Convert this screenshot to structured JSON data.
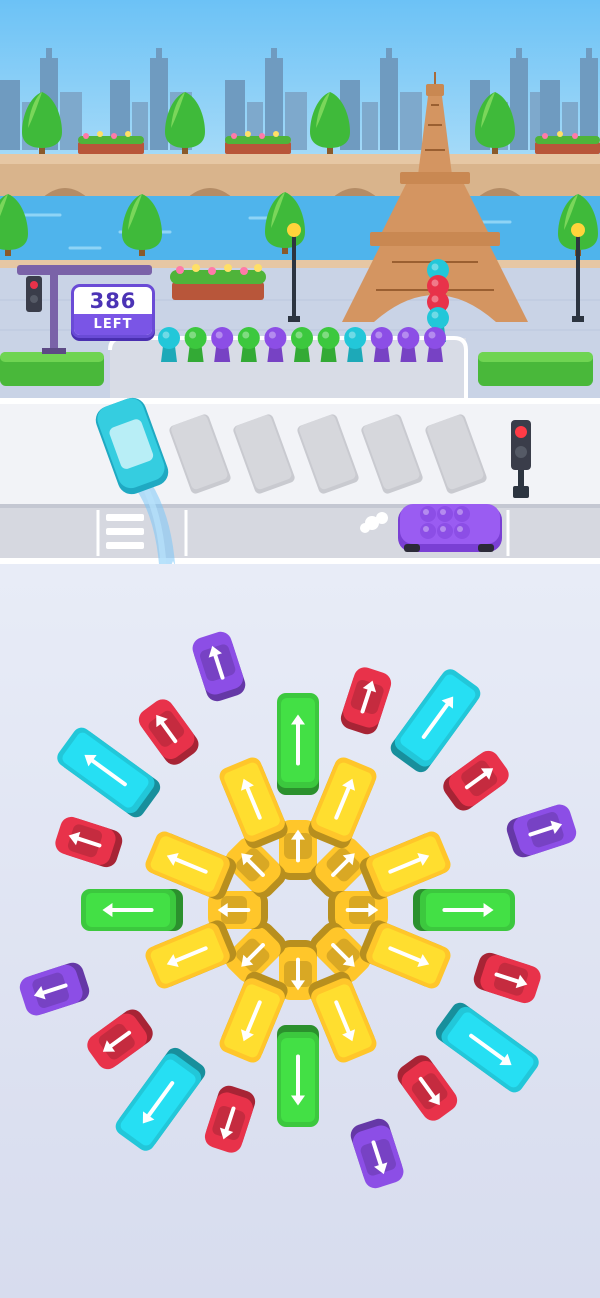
{
  "counter": {
    "value": "386",
    "label": "LEFT"
  },
  "colors": {
    "sky": "#7fc8f5",
    "river": "#4fb4ec",
    "grass": "#4fc43a",
    "road": "#d6d8e0",
    "red": "#e8324a",
    "purple": "#8c4ee6",
    "cyan": "#22c7d9",
    "green": "#3cc83e",
    "yellow": "#ffc62a"
  },
  "passenger_queue": [
    "cyan",
    "green",
    "purple",
    "green",
    "purple",
    "green",
    "green",
    "cyan",
    "purple",
    "purple",
    "purple"
  ],
  "passengers_at_tower": [
    "cyan",
    "red",
    "red",
    "cyan"
  ],
  "parked_car_passengers": [
    "purple",
    "purple",
    "purple",
    "purple",
    "purple",
    "purple"
  ],
  "parking_slots": {
    "total": 5,
    "occupied": 1
  },
  "vehicle_ring": [
    {
      "color": "green",
      "type": "bus"
    },
    {
      "color": "red",
      "type": "car"
    },
    {
      "color": "cyan",
      "type": "bus"
    },
    {
      "color": "red",
      "type": "car"
    },
    {
      "color": "purple",
      "type": "car"
    },
    {
      "color": "green",
      "type": "bus"
    },
    {
      "color": "red",
      "type": "car"
    },
    {
      "color": "cyan",
      "type": "bus"
    },
    {
      "color": "red",
      "type": "car"
    },
    {
      "color": "purple",
      "type": "car"
    },
    {
      "color": "green",
      "type": "bus"
    },
    {
      "color": "red",
      "type": "car"
    },
    {
      "color": "cyan",
      "type": "bus"
    },
    {
      "color": "red",
      "type": "car"
    },
    {
      "color": "purple",
      "type": "car"
    },
    {
      "color": "green",
      "type": "bus"
    },
    {
      "color": "red",
      "type": "car"
    },
    {
      "color": "cyan",
      "type": "bus"
    },
    {
      "color": "red",
      "type": "car"
    },
    {
      "color": "purple",
      "type": "car"
    }
  ],
  "inner_ring_color": "yellow"
}
